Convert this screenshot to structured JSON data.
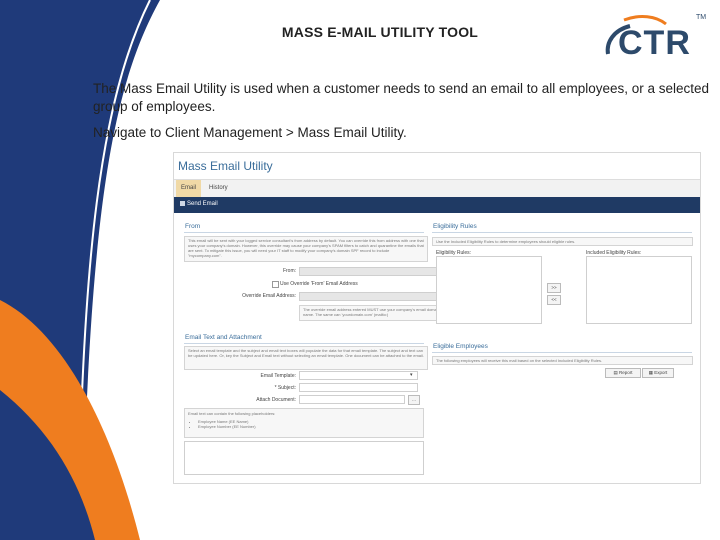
{
  "slide": {
    "title": "MASS E-MAIL UTILITY TOOL",
    "intro": "The Mass Email Utility is used when a customer needs to send an email to all employees, or a selected group of employees.",
    "nav": "Navigate to Client Management > Mass Email Utility.",
    "colors": {
      "blue": "#1f3a7a",
      "orange": "#ef7d1f"
    }
  },
  "logo": {
    "text": "CTR",
    "tm": "TM"
  },
  "app": {
    "title": "Mass Email Utility",
    "tabs": {
      "email": "Email",
      "history": "History"
    },
    "toolbar": {
      "send": "Send Email"
    },
    "from": {
      "heading": "From",
      "note": "This email will be sent with your logged service consultant's from address by default. You can override this from address with one that uses your company's domain. However, this override may cause your company's SPAM filters to catch and quarantine the emails that are sent. To mitigate this issue, you will need your IT staff to modify your company's domain SPF record to include \"mycompany.com\".",
      "from_label": "From:",
      "use_override_label": "Use Override 'From' Email Address",
      "override_label": "Override Email Address:",
      "override_note": "The override email address entered MUST use your company's email domain name. The same can 'yourdomain.com' (mailto:)"
    },
    "eligibility": {
      "heading": "Eligibility Rules",
      "note": "Use the Included Eligibility Rules to determine employees should eligible rules.",
      "eligibility_rules_label": "Eligibility Rules:",
      "included_rules_label": "Included Eligibility Rules:",
      "add_btn": ">>",
      "remove_btn": "<<"
    },
    "text_attachment": {
      "heading": "Email Text and Attachment",
      "note": "Select an email template and the subject and email text boxes will populate the data for that email template. The subject and text can be updated here. Or, key the Subject and Email text without selecting an email template. One document can be attached to the email.",
      "template_label": "Email Template:",
      "subject_label": "* Subject:",
      "attach_label": "Attach Document:",
      "browse_btn": "...",
      "placeholders_intro": "Email text can contain the following placeholders:",
      "placeholders": [
        "Employee Name (EE Name)",
        "Employee Number (EE Number)"
      ]
    },
    "eligible": {
      "heading": "Eligible Employees",
      "note": "The following employees will receive this mail based on the selected Included Eligibility Rules.",
      "report_btn": "Report",
      "export_btn": "Export"
    }
  }
}
